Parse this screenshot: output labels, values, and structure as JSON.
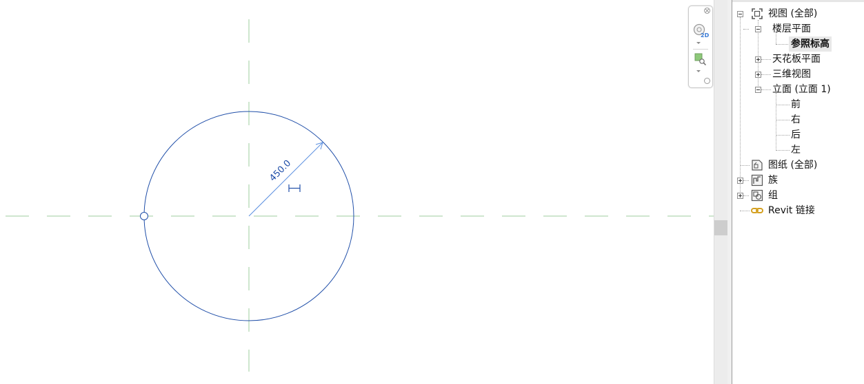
{
  "canvas": {
    "dimension_label": "450.0"
  },
  "browser": {
    "items": [
      {
        "label": "视图 (全部)",
        "icon": "views-icon",
        "expander": "minus"
      },
      {
        "label": "楼层平面",
        "expander": "minus"
      },
      {
        "label": "参照标高",
        "bold": true,
        "selected": true
      },
      {
        "label": "天花板平面",
        "expander": "plus"
      },
      {
        "label": "三维视图",
        "expander": "plus"
      },
      {
        "label": "立面 (立面 1)",
        "expander": "minus"
      },
      {
        "label": "前"
      },
      {
        "label": "右"
      },
      {
        "label": "后"
      },
      {
        "label": "左"
      },
      {
        "label": "图纸 (全部)",
        "icon": "sheets-icon"
      },
      {
        "label": "族",
        "icon": "families-icon",
        "expander": "plus"
      },
      {
        "label": "组",
        "icon": "groups-icon",
        "expander": "plus"
      },
      {
        "label": "Revit 链接",
        "icon": "revit-links-icon"
      }
    ]
  },
  "colors": {
    "circle": "#1f4ea8",
    "reference_plane": "#9ccc9c",
    "dimension": "#5b8fe0",
    "link_icon": "#d4a020"
  }
}
